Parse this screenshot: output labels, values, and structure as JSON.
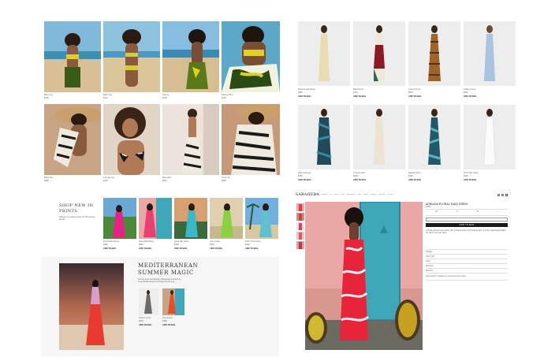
{
  "grid_products": [
    {
      "name": "Bikini Set",
      "price": "$180"
    },
    {
      "name": "Bikini Top",
      "price": "$110"
    },
    {
      "name": "Sarong",
      "price": "$150"
    },
    {
      "name": "Sarong Print",
      "price": "$165"
    },
    {
      "name": "Bikini Set",
      "price": "$180"
    },
    {
      "name": "Triangle Top",
      "price": "$120"
    },
    {
      "name": "Maxi Skirt",
      "price": "$240"
    },
    {
      "name": "Cover Up",
      "price": "$260"
    }
  ],
  "dress_products": [
    {
      "name": "Mariana Slip Dress",
      "price": "$395",
      "cta": "ADD TO BAG"
    },
    {
      "name": "Bella Dress",
      "price": "$420",
      "cta": "ADD TO BAG"
    },
    {
      "name": "Leonie Dress",
      "price": "$375",
      "cta": "ADD TO BAG"
    },
    {
      "name": "Azalea Gown",
      "price": "$410",
      "cta": "ADD TO BAG"
    },
    {
      "name": "Paloma Dress",
      "price": "$395",
      "cta": "ADD TO BAG"
    },
    {
      "name": "Lorena Gown",
      "price": "$385",
      "cta": "ADD TO BAG"
    },
    {
      "name": "Valeria Dress",
      "price": "$360",
      "cta": "ADD TO BAG"
    },
    {
      "name": "Nova Slip Gown",
      "price": "$390",
      "cta": "ADD TO BAG"
    }
  ],
  "shop_new": {
    "heading_line1": "SHOP NEW IN",
    "heading_line2": "PRINTS",
    "subtext": "Discover our latest prints for the season ahead",
    "products": [
      {
        "name": "Floral Maxi Dress",
        "price": "$395",
        "cta": "ADD TO BAG"
      },
      {
        "name": "Rosa Midi Dress",
        "price": "$340",
        "cta": "ADD TO BAG"
      },
      {
        "name": "Aqua Slip Dress",
        "price": "$360",
        "cta": "ADD TO BAG"
      },
      {
        "name": "Lime Gown",
        "price": "$410",
        "cta": "ADD TO BAG"
      },
      {
        "name": "Palm Print Dress",
        "price": "$380",
        "cta": "ADD TO BAG"
      }
    ]
  },
  "mediterranean": {
    "heading_line1": "MEDITERRANEAN",
    "heading_line2": "SUMMER MAGIC",
    "body": "Sunset hues and flowing silhouettes inspired by long Mediterranean evenings by the sea.",
    "products": [
      {
        "name": "Ombre Gown",
        "price": "$420",
        "cta": "ADD TO BAG"
      },
      {
        "name": "Print Dress",
        "price": "$395",
        "cta": "ADD TO BAG"
      }
    ]
  },
  "pdp": {
    "brand": "SARAHEDA",
    "nav": [
      "NEW IN",
      "DRESSES",
      "TOPS",
      "SKIRTS",
      "SWIM",
      "ACCESSORIES",
      "SALE",
      "ABOUT",
      "JOURNAL",
      "STOCKISTS",
      "STORES"
    ],
    "header_icons": [
      "search-icon",
      "account-icon",
      "bag-icon"
    ],
    "product_title": "ADRIANA FLORAL MAXI DRESS",
    "price": "$395",
    "sizes": [
      "XS",
      "S",
      "M",
      "L"
    ],
    "add_button": "ADD TO BAG",
    "description": "A floral printed maxi dress with a fitted bodice and flowing skirt, cut from lightweight fabric for warm summer days.",
    "details": [
      "Details",
      "Size & Fit",
      "Care",
      "Delivery",
      "Returns"
    ],
    "help_text": "Need help? Contact our customer care team."
  },
  "colors": {
    "page_bg": "#ffffff",
    "card_gray": "#f0f0f0",
    "dark_button": "#1a1a1a",
    "pink_wall": "#e9a8a6",
    "teal_door": "#3fa8b8"
  }
}
